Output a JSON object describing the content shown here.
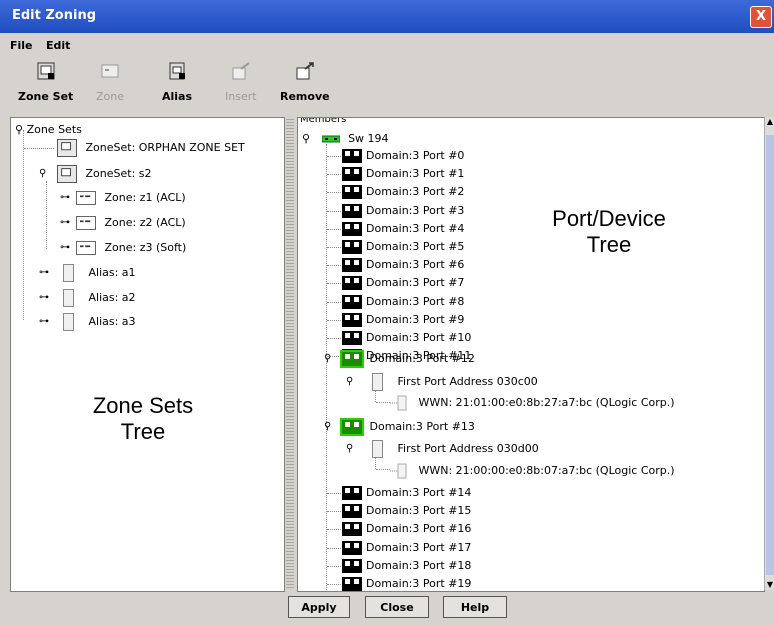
{
  "window": {
    "title": "Edit Zoning",
    "close_glyph": "X"
  },
  "menu": [
    "File",
    "Edit"
  ],
  "toolbar": [
    {
      "label": "Zone Set",
      "icon": "zone-set-icon",
      "enabled": true
    },
    {
      "label": "Zone",
      "icon": "zone-icon",
      "enabled": false
    },
    {
      "label": "Alias",
      "icon": "alias-icon",
      "enabled": true
    },
    {
      "label": "Insert",
      "icon": "insert-icon",
      "enabled": false
    },
    {
      "label": "Remove",
      "icon": "remove-icon",
      "enabled": true
    }
  ],
  "zone_tree": {
    "root": "Zone Sets",
    "orphan": "ZoneSet: ORPHAN ZONE SET",
    "zoneset": "ZoneSet: s2",
    "zones": [
      "Zone: z1 (ACL)",
      "Zone: z2 (ACL)",
      "Zone: z3 (Soft)"
    ],
    "aliases": [
      "Alias: a1",
      "Alias: a2",
      "Alias: a3"
    ]
  },
  "zone_sets_caption": "Zone Sets\nTree",
  "port_device_caption": "Port/Device\nTree",
  "members": {
    "header": "Members",
    "switch": "Sw 194",
    "ports_a": [
      "Domain:3 Port #0",
      "Domain:3 Port #1",
      "Domain:3 Port #2",
      "Domain:3 Port #3",
      "Domain:3 Port #4",
      "Domain:3 Port #5",
      "Domain:3 Port #6",
      "Domain:3 Port #7",
      "Domain:3 Port #8",
      "Domain:3 Port #9",
      "Domain:3 Port #10",
      "Domain:3 Port #11"
    ],
    "port12": "Domain:3 Port #12",
    "port12_addr": "First Port Address 030c00",
    "port12_wwn": "WWN: 21:01:00:e0:8b:27:a7:bc (QLogic Corp.)",
    "port13": "Domain:3 Port #13",
    "port13_addr": "First Port Address 030d00",
    "port13_wwn": "WWN: 21:00:00:e0:8b:07:a7:bc (QLogic Corp.)",
    "ports_b": [
      "Domain:3 Port #14",
      "Domain:3 Port #15",
      "Domain:3 Port #16",
      "Domain:3 Port #17",
      "Domain:3 Port #18",
      "Domain:3 Port #19"
    ]
  },
  "buttons": {
    "apply": "Apply",
    "close": "Close",
    "help": "Help"
  }
}
